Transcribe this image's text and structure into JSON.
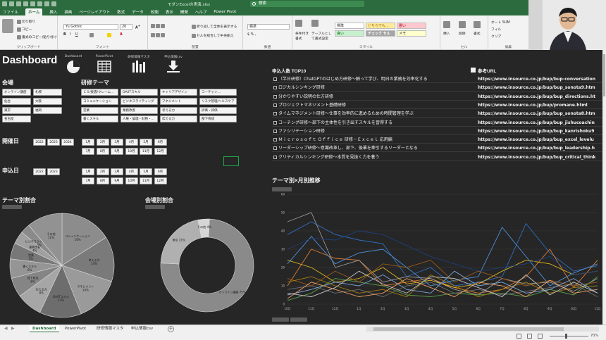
{
  "window": {
    "file_title": "モダンExcelの実演.xlsx",
    "search_placeholder": "検索"
  },
  "ribbon_tabs": [
    "ファイル",
    "ホーム",
    "挿入",
    "描画",
    "ページレイアウト",
    "数式",
    "データ",
    "校閲",
    "表示",
    "開発",
    "ヘルプ",
    "Power Pivot"
  ],
  "ribbon": {
    "clipboard": {
      "cut": "切り取り",
      "copy": "コピー",
      "format_painter": "書式のコピー/貼り付け",
      "label": "クリップボード"
    },
    "font": {
      "name": "Yu Gothic",
      "size": "20",
      "label": "フォント"
    },
    "alignment": {
      "wrap": "折り返して全体を表示する",
      "merge": "セルを結合して中央揃え",
      "label": "配置"
    },
    "number": {
      "format": "標準",
      "label": "数値"
    },
    "styles": {
      "conditional": "条件付き書式",
      "table": "テーブルとして書式設定",
      "cells_styles": [
        "標準",
        "どちらでも...",
        "悪い",
        "良い",
        "チェック セル",
        "メモ"
      ],
      "label": "スタイル"
    },
    "cells": {
      "insert": "挿入",
      "delete": "削除",
      "format": "書式",
      "label": "セル"
    },
    "editing": {
      "autosum": "オート SUM",
      "fill": "フィル",
      "clear": "クリア",
      "label": "編集"
    }
  },
  "dashboard": {
    "title": "Dashboard",
    "nav": [
      "Dashboard",
      "PowerPivot",
      "研修情報マスタ",
      "申込情報csv"
    ],
    "venue": {
      "heading": "会場",
      "items": [
        "オンライン講座",
        "札幌",
        "仙台",
        "大阪",
        "東京",
        "福岡",
        "名古屋"
      ]
    },
    "theme": {
      "heading": "研修テーマ",
      "items": [
        "ＣＳ/接遇/クレーム...",
        "OA/ITスキル",
        "キャリアデザイン",
        "コーチャン...",
        "コミュニケーション",
        "ビジネスライティング",
        "マネジメント",
        "リスク管理/ヘルスケア",
        "営業",
        "業務改善",
        "考える力",
        "評価・評価",
        "書くスキル",
        "人権・倫理・財務・...",
        "伝える力",
        "部下育成"
      ]
    },
    "held_date": {
      "heading": "開催日",
      "years": [
        "2022",
        "2023",
        "2024"
      ],
      "months": [
        "1月",
        "2月",
        "3月",
        "4月",
        "5月",
        "6月",
        "7月",
        "8月",
        "9月",
        "10月",
        "11月",
        "12月"
      ]
    },
    "apply_date": {
      "heading": "申込日",
      "years": [
        "2022",
        "2023"
      ],
      "months": [
        "1月",
        "2月",
        "3月",
        "4月",
        "5月",
        "6月",
        "7月",
        "8月",
        "9月",
        "10月",
        "11月",
        "12月"
      ]
    },
    "top10": {
      "heading": "申込人数 TOP10",
      "url_heading": "参考URL",
      "rows": [
        {
          "name": "（半日研修）ChatGPTのはじめ方研修～触って学び、明日の業務を効率化する",
          "url": "https://www.insource.co.jp/bup/bup-conversation"
        },
        {
          "name": "ロジカルシンキング研修",
          "url": "https://www.insource.co.jp/bup/bup_sonota9.htm"
        },
        {
          "name": "分かりやすい説明の仕方研修",
          "url": "https://www.insource.co.jp/bup/bup_directions.ht"
        },
        {
          "name": "プロジェクトマネジメント基礎研修",
          "url": "https://www.insource.co.jp/bup/promane.html"
        },
        {
          "name": "タイムマネジメント研修～仕事を効率的に進めるための時間管理を学ぶ",
          "url": "https://www.insource.co.jp/bup/bup_sonota8.htm"
        },
        {
          "name": "コーチング研修～部下の主体性を引き出すスキルを習得する",
          "url": "https://www.insource.co.jp/bup/bup_jishucoachin"
        },
        {
          "name": "ファシリテーション研修",
          "url": "https://www.insource.co.jp/bup/bup_kanrishoku9"
        },
        {
          "name": "Ｍｉｃｒｏｓｏｆｔ Ｏｆｆｉｃｅ 研修－Ｅｘｃｅｌ 応用編",
          "url": "https://www.insource.co.jp/bup/bup_excel_levelu"
        },
        {
          "name": "リーダーシップ研修～意識改革し、部下、後輩を牽引するリーダーとなる",
          "url": "https://www.insource.co.jp/bup/bup_leadership.h"
        },
        {
          "name": "クリティカルシンキング研修～本質を見抜く力を養う",
          "url": "https://www.insource.co.jp/bup/bup_critical_think"
        }
      ]
    },
    "sheet_tabs": [
      "Dashboard",
      "PowerPivot",
      "研修情報マスタ",
      "申込情報csv"
    ],
    "zoom": "70%"
  },
  "chart_data": [
    {
      "type": "pie",
      "title": "テーマ別割合",
      "labels": [
        "コミュニケーション",
        "考える力",
        "マネジメント",
        "OA/ITスキル",
        "伝える力",
        "部下育成",
        "書くスキル",
        "営業",
        "業務改善",
        "ビジネスライティング",
        "その他"
      ],
      "values": [
        16,
        14,
        14,
        13,
        8,
        6,
        6,
        5,
        4,
        3,
        11
      ]
    },
    {
      "type": "pie",
      "title": "会場別割合",
      "labels": [
        "オンライン講座",
        "東京",
        "その他"
      ],
      "values": [
        75,
        21,
        4
      ]
    },
    {
      "type": "line",
      "title": "テーマ別×月別推移",
      "x": [
        "10月",
        "11月",
        "12月",
        "1月",
        "2月",
        "3月",
        "4月",
        "5月",
        "6月",
        "7月",
        "8月",
        "9月",
        "10月",
        "11月"
      ],
      "ylim": [
        0,
        60
      ],
      "series": [
        {
          "color": "#2f6fc1",
          "values": [
            38,
            45,
            38,
            35,
            33,
            15,
            20,
            10,
            12,
            15,
            44,
            28,
            18,
            21
          ]
        },
        {
          "color": "#e07b2b",
          "values": [
            10,
            30,
            25,
            24,
            10,
            12,
            14,
            9,
            6,
            8,
            15,
            30,
            9,
            24
          ]
        },
        {
          "color": "#9a9a9a",
          "values": [
            45,
            50,
            20,
            24,
            12,
            15,
            14,
            8,
            5,
            14,
            11,
            12,
            7,
            14
          ]
        },
        {
          "color": "#d8b41e",
          "values": [
            24,
            20,
            12,
            14,
            20,
            11,
            13,
            9,
            11,
            18,
            24,
            22,
            16,
            18
          ]
        },
        {
          "color": "#4e8fd6",
          "values": [
            22,
            37,
            22,
            28,
            30,
            20,
            10,
            13,
            15,
            42,
            26,
            10,
            17,
            22
          ]
        },
        {
          "color": "#5aa04a",
          "values": [
            2,
            6,
            14,
            12,
            10,
            5,
            4,
            6,
            5,
            6,
            4,
            8,
            5,
            15
          ]
        },
        {
          "color": "#1f3f7a",
          "values": [
            30,
            36,
            35,
            40,
            38,
            32,
            26,
            22,
            18,
            20,
            22,
            26,
            16,
            18
          ]
        },
        {
          "color": "#9b5b1a",
          "values": [
            14,
            10,
            18,
            12,
            22,
            20,
            24,
            12,
            18,
            14,
            10,
            13,
            10,
            12
          ]
        },
        {
          "color": "#6e6e6e",
          "values": [
            8,
            10,
            6,
            8,
            4,
            10,
            12,
            6,
            8,
            5,
            7,
            9,
            11,
            4
          ]
        },
        {
          "color": "#a07c10",
          "values": [
            12,
            15,
            10,
            6,
            8,
            4,
            16,
            10,
            4,
            8,
            12,
            6,
            9,
            10
          ]
        },
        {
          "color": "#7fa6d9",
          "values": [
            5,
            8,
            12,
            10,
            16,
            8,
            6,
            18,
            10,
            12,
            6,
            8,
            14,
            6
          ]
        },
        {
          "color": "#f0a060",
          "values": [
            3,
            12,
            8,
            4,
            6,
            14,
            9,
            4,
            12,
            10,
            4,
            13,
            6,
            8
          ]
        },
        {
          "color": "#c0c0c0",
          "values": [
            6,
            4,
            9,
            18,
            11,
            6,
            15,
            14,
            9,
            4,
            16,
            5,
            12,
            6
          ]
        }
      ]
    }
  ]
}
